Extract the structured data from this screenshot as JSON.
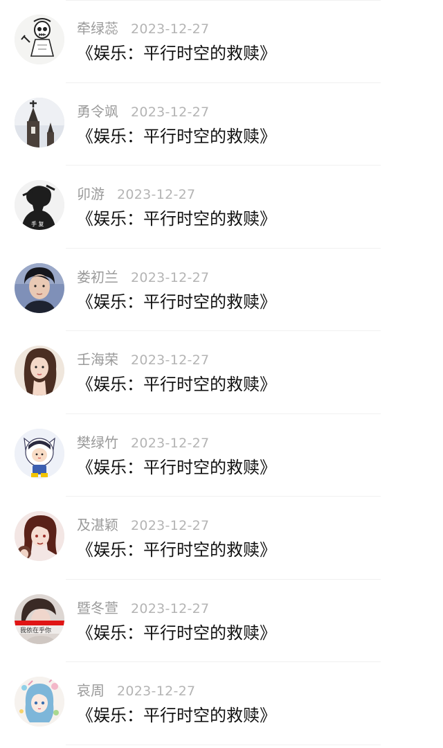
{
  "comments": [
    {
      "username": "牵绿蕊",
      "date": "2023-12-27",
      "title": "《娱乐：平行时空的救赎》",
      "avatar_icon": "skeleton-drawing-avatar"
    },
    {
      "username": "勇令飒",
      "date": "2023-12-27",
      "title": "《娱乐：平行时空的救赎》",
      "avatar_icon": "church-spire-avatar"
    },
    {
      "username": "卯游",
      "date": "2023-12-27",
      "title": "《娱乐：平行时空的救赎》",
      "avatar_icon": "silhouette-avatar"
    },
    {
      "username": "娄初兰",
      "date": "2023-12-27",
      "title": "《娱乐：平行时空的救赎》",
      "avatar_icon": "man-portrait-avatar"
    },
    {
      "username": "壬海荣",
      "date": "2023-12-27",
      "title": "《娱乐：平行时空的救赎》",
      "avatar_icon": "woman-portrait-avatar"
    },
    {
      "username": "樊绿竹",
      "date": "2023-12-27",
      "title": "《娱乐：平行时空的救赎》",
      "avatar_icon": "cartoon-kid-avatar"
    },
    {
      "username": "及湛颖",
      "date": "2023-12-27",
      "title": "《娱乐：平行时空的救赎》",
      "avatar_icon": "anime-character-avatar"
    },
    {
      "username": "暨冬萱",
      "date": "2023-12-27",
      "title": "《娱乐：平行时空的救赎》",
      "avatar_icon": "red-banner-portrait-avatar",
      "avatar_caption": "我依在乎你"
    },
    {
      "username": "哀周",
      "date": "2023-12-27",
      "title": "《娱乐：平行时空的救赎》",
      "avatar_icon": "illustrated-girl-avatar"
    }
  ],
  "colors": {
    "username": "#9a9a9a",
    "date": "#b4b4b4",
    "title": "#111111",
    "divider": "#f0f0f0",
    "banner_red": "#e01515"
  }
}
